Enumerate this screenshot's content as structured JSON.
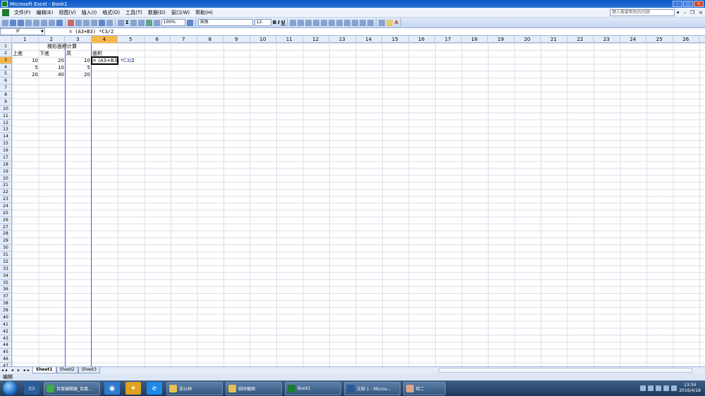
{
  "window": {
    "title": "Microsoft Excel - Book1"
  },
  "menu": {
    "items": [
      "文件(F)",
      "编辑(E)",
      "视图(V)",
      "插入(I)",
      "格式(O)",
      "工具(T)",
      "数据(D)",
      "窗口(W)",
      "帮助(H)"
    ],
    "help_placeholder": "键入需要帮助的问题"
  },
  "toolbar": {
    "zoom": "100%",
    "font": "宋体",
    "font_size": "12",
    "bold": "B",
    "italic": "I",
    "underline": "U"
  },
  "formula_bar": {
    "name_box": "IF",
    "formula": "= (A3+B3) *C3/2"
  },
  "columns": [
    "1",
    "2",
    "3",
    "4",
    "5",
    "6",
    "7",
    "8",
    "9",
    "10",
    "11",
    "12",
    "13",
    "14",
    "15",
    "16",
    "17",
    "18",
    "19",
    "20",
    "21",
    "22",
    "23",
    "24",
    "25",
    "26"
  ],
  "rows": [
    "1",
    "2",
    "3",
    "4",
    "5",
    "6",
    "7",
    "8",
    "9",
    "10",
    "11",
    "12",
    "13",
    "14",
    "15",
    "16",
    "17",
    "18",
    "19",
    "20",
    "21",
    "22",
    "23",
    "24",
    "25",
    "26",
    "27",
    "28",
    "29",
    "30",
    "31",
    "32",
    "33",
    "34",
    "35",
    "36",
    "37",
    "38",
    "39",
    "40",
    "41",
    "42",
    "43",
    "44",
    "45",
    "46",
    "47"
  ],
  "cells": {
    "title": "梯形面积计算",
    "h_top": "上底",
    "h_bottom": "下底",
    "h_height": "高",
    "h_area": "面积",
    "r3": [
      "10",
      "20",
      "10"
    ],
    "r4": [
      "5",
      "10",
      "5"
    ],
    "r5": [
      "20",
      "40",
      "20"
    ],
    "edit_formula_prefix": "= (A3+B3) *",
    "edit_formula_ref": "C3",
    "edit_formula_suffix": "/2"
  },
  "sheets": [
    "Sheet1",
    "Sheet2",
    "Sheet3"
  ],
  "status": {
    "mode": "编辑"
  },
  "taskbar": {
    "buttons": [
      "百度编辑器_百度...",
      "张以林",
      "临时截图",
      "Book1",
      "文档 1 - Micros...",
      "哈二"
    ],
    "time": "13:34",
    "date": "2016/4/18"
  }
}
